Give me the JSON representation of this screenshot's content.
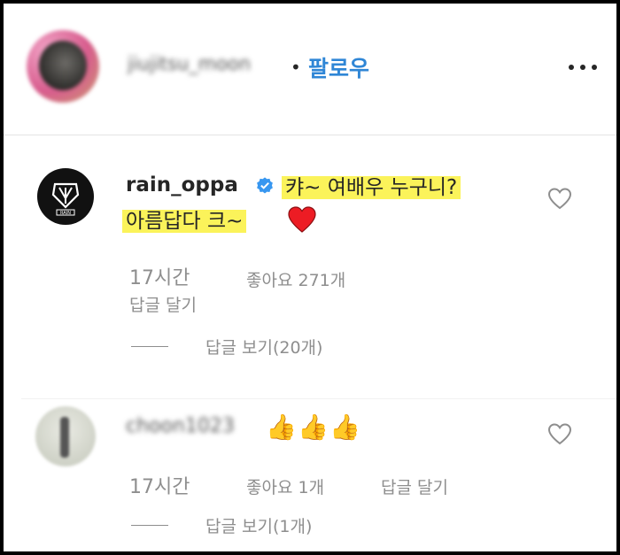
{
  "post_header": {
    "account_name_blurred": "jiujitsu_moon",
    "separator": "•",
    "follow_label": "팔로우",
    "more_icon": "more-horizontal-icon"
  },
  "comments": [
    {
      "username": "rain_oppa",
      "verified": true,
      "avatar_badge": "RAIN",
      "text_line1": "캬~ 여배우 누구니?",
      "text_line2": "아름답다 크~",
      "time": "17시간",
      "likes": "좋아요 271개",
      "reply_label": "답글 달기",
      "view_replies": "답글 보기(20개)",
      "highlight_color": "#fbf35a"
    },
    {
      "username_blurred": "choon1023",
      "emoji": [
        "👍",
        "👍",
        "👍"
      ],
      "time": "17시간",
      "likes": "좋아요 1개",
      "reply_label": "답글 달기",
      "view_replies": "답글 보기(1개)"
    }
  ],
  "colors": {
    "follow_blue": "#2f86d6",
    "meta_gray": "#8e8e8e",
    "heart_red": "#ed1c24"
  }
}
